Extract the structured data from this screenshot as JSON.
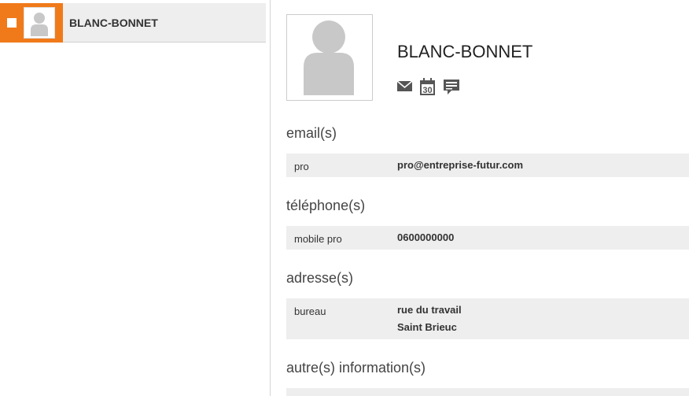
{
  "sidebar": {
    "contacts": [
      {
        "name": "BLANC-BONNET",
        "selected": true
      }
    ]
  },
  "contact": {
    "name": "BLANC-BONNET",
    "actions": [
      {
        "icon": "email-icon"
      },
      {
        "icon": "calendar-icon",
        "label": "30"
      },
      {
        "icon": "message-icon"
      }
    ]
  },
  "sections": {
    "email": {
      "title": "email(s)",
      "rows": [
        {
          "label": "pro",
          "value": "pro@entreprise-futur.com"
        }
      ]
    },
    "phone": {
      "title": "téléphone(s)",
      "rows": [
        {
          "label": "mobile pro",
          "value": "0600000000"
        }
      ]
    },
    "address": {
      "title": "adresse(s)",
      "rows": [
        {
          "label": "bureau",
          "line1": "rue du travail",
          "line2": "Saint Brieuc"
        }
      ]
    },
    "other": {
      "title": "autre(s) information(s)"
    }
  },
  "colors": {
    "accent": "#f07a1a",
    "row_bg": "#eeeeee",
    "avatar_gray": "#c8c8c8"
  }
}
